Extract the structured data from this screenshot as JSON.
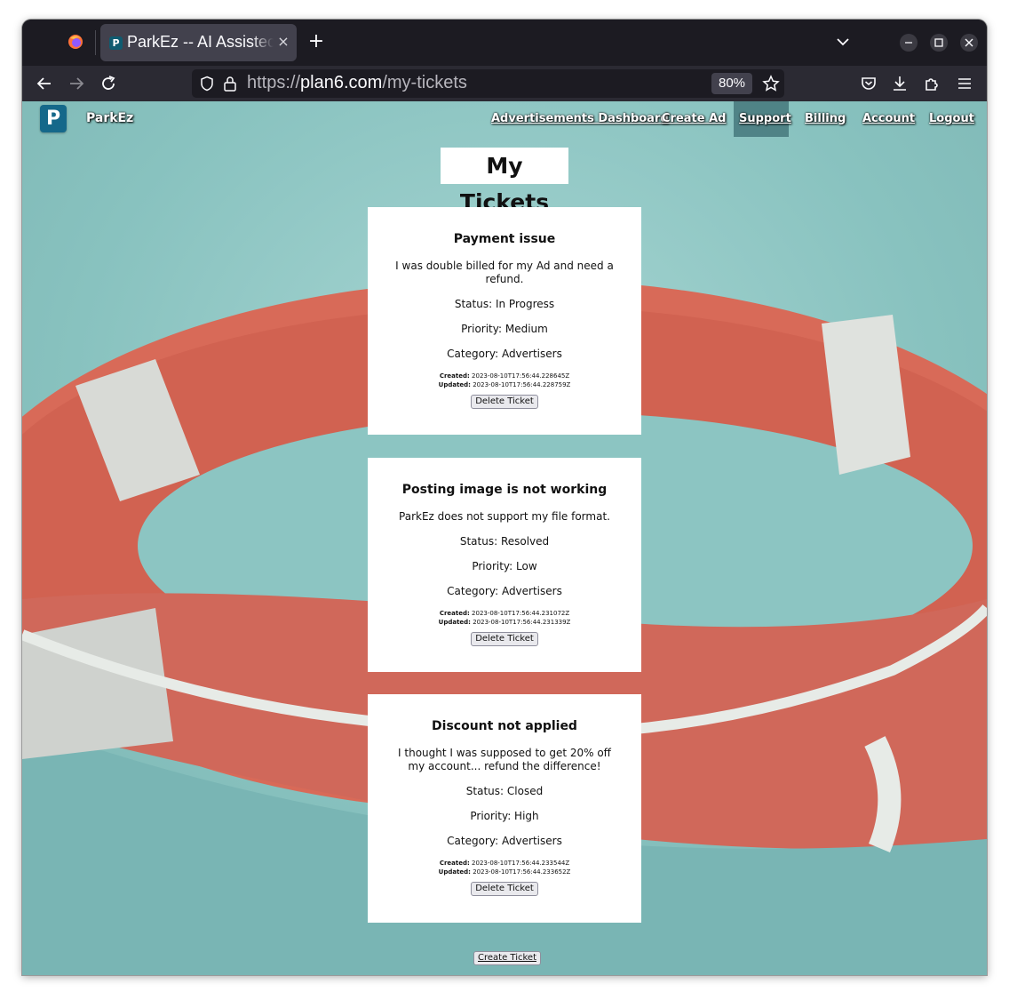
{
  "browser": {
    "tab_title": "ParkEz -- AI Assistec",
    "tab_favicon": "P",
    "tab_close": "×",
    "new_tab": "+",
    "url_scheme": "https://",
    "url_domain": "plan6.com",
    "url_path": "/my-tickets",
    "zoom": "80%"
  },
  "site": {
    "logo_letter": "P",
    "brand": "ParkEz",
    "nav": [
      {
        "label": "Advertisements Dashboard"
      },
      {
        "label": "Create Ad"
      },
      {
        "label": "Support"
      },
      {
        "label": "Billing"
      },
      {
        "label": "Account"
      },
      {
        "label": "Logout"
      }
    ]
  },
  "page": {
    "title": "My Tickets",
    "created_label": "Created:",
    "updated_label": "Updated:",
    "delete_label": "Delete Ticket",
    "create_label": "Create Ticket",
    "tickets": [
      {
        "title": "Payment issue",
        "description": "I was double billed for my Ad and need a refund.",
        "status": "Status: In Progress",
        "priority": "Priority: Medium",
        "category": "Category: Advertisers",
        "created": "2023-08-10T17:56:44.228645Z",
        "updated": "2023-08-10T17:56:44.228759Z"
      },
      {
        "title": "Posting image is not working",
        "description": "ParkEz does not support my file format.",
        "status": "Status: Resolved",
        "priority": "Priority: Low",
        "category": "Category: Advertisers",
        "created": "2023-08-10T17:56:44.231072Z",
        "updated": "2023-08-10T17:56:44.231339Z"
      },
      {
        "title": "Discount not applied",
        "description": "I thought I was supposed to get 20% off my account... refund the difference!",
        "status": "Status: Closed",
        "priority": "Priority: High",
        "category": "Category: Advertisers",
        "created": "2023-08-10T17:56:44.233544Z",
        "updated": "2023-08-10T17:56:44.233652Z"
      }
    ]
  }
}
